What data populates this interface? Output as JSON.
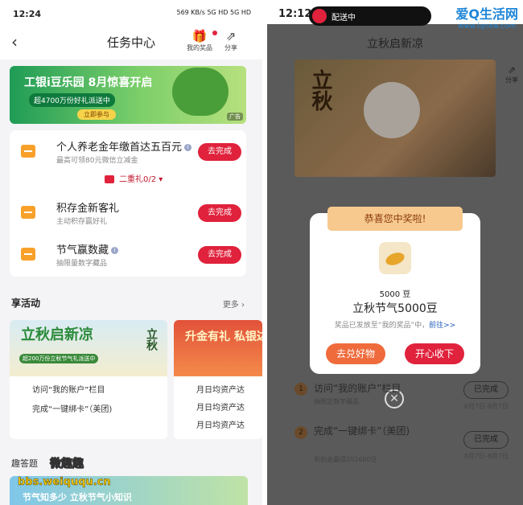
{
  "left": {
    "status": {
      "time": "12:24",
      "signal": "569 KB/s 5G HD 5G HD"
    },
    "nav": {
      "title": "任务中心",
      "prizes_label": "我的奖品",
      "share_label": "分享"
    },
    "banner": {
      "title": "工银i豆乐园 8月惊喜开启",
      "subtitle": "超4700万份好礼派送中",
      "cta": "立即参与",
      "tag": "广告"
    },
    "tasks": [
      {
        "title": "个人养老金年缴首达五百元",
        "desc": "最高可领80元微信立减金",
        "button": "去完成"
      },
      {
        "title": "积存金新客礼",
        "desc": "主动积存赢好礼",
        "button": "去完成"
      },
      {
        "title": "节气赢数藏",
        "desc": "抽限量数字藏品",
        "button": "去完成"
      }
    ],
    "gift_level": "二重礼0/2",
    "activities": {
      "title": "享活动",
      "more": "更多",
      "card1_banner": "立秋启新凉",
      "card1_sub": "超200万份立秋节气礼派送中",
      "card1_badge": "立秋",
      "card1_lines": [
        "访问“我的账户”栏目",
        "完成“一键绑卡”（美团)"
      ],
      "card2_banner": "升金有礼 私银达标礼",
      "card2_lines": [
        "月日均资产达",
        "月日均资产达",
        "月日均资产达"
      ]
    },
    "quiz": {
      "title": "趣答题",
      "banner": "节气知多少 立秋节气小知识"
    },
    "overlay": {
      "brand": "微趣趣",
      "url": "bbs.weiququ.cn"
    }
  },
  "right": {
    "status": {
      "time": "12:12",
      "delivery": "配送中"
    },
    "watermark": {
      "brand": "爱Q生活网",
      "url": "www.iqnew.com"
    },
    "title": "立秋启新凉",
    "share_label": "分享",
    "poster_text": "立秋",
    "popup": {
      "ribbon": "恭喜您中奖啦!",
      "amount": "5000 豆",
      "prize": "立秋节气5000豆",
      "note": "奖品已发放至“我的奖品”中，",
      "link": "前往>>",
      "btn_left": "去兑好物",
      "btn_right": "开心收下"
    },
    "tasks": [
      {
        "num": "1",
        "title": "访问“我的账户”栏目",
        "desc": "抽限定数字藏品",
        "button": "已完成",
        "date": "8月7日-8月7日"
      },
      {
        "num": "2",
        "title": "完成“一键绑卡”（美团)",
        "desc": "有机会赢得202600豆",
        "button": "已完成",
        "date": "8月7日-8月7日"
      }
    ],
    "close_icon": "close-icon"
  },
  "colors": {
    "accent": "#e0223c",
    "popup_btn": "#ef6b3c",
    "ribbon": "#f7c98e"
  }
}
